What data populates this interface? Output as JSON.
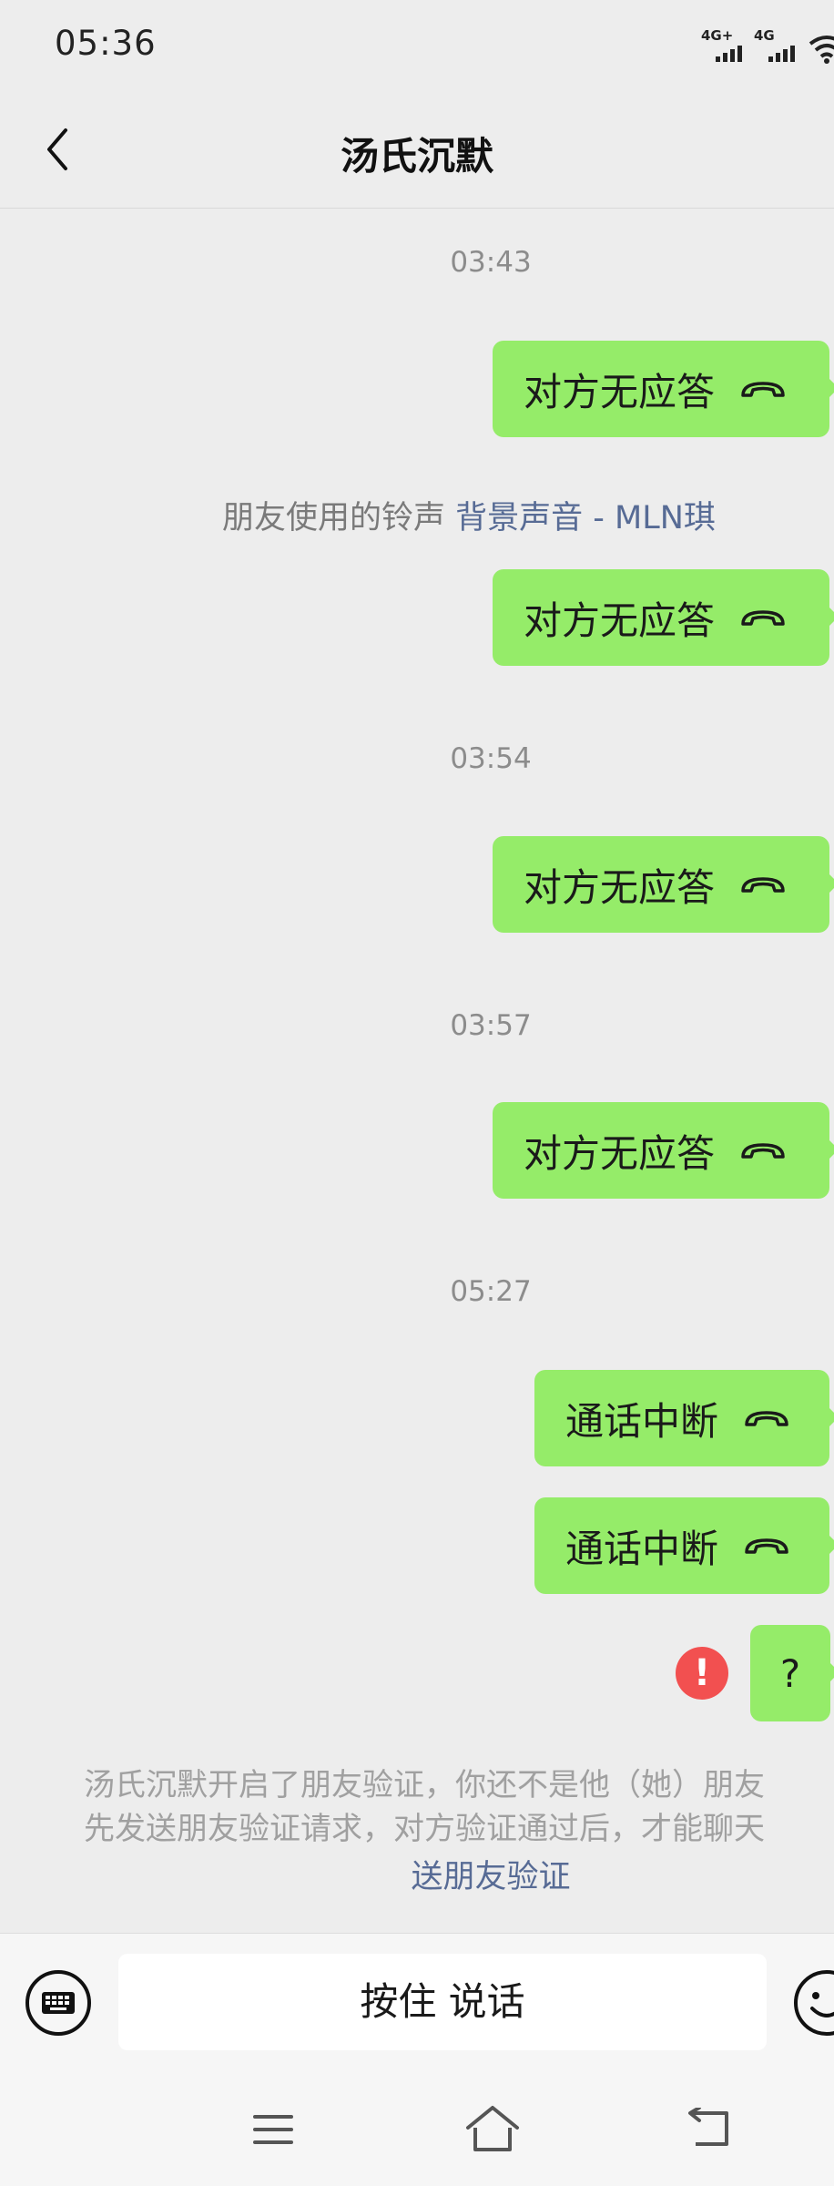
{
  "status_bar": {
    "time": "05:36",
    "network_1": "4G+",
    "network_2": "4G",
    "wifi_icon": "wifi-icon"
  },
  "header": {
    "title": "汤氏沉默",
    "back_icon": "back-arrow-icon"
  },
  "messages": [
    {
      "type": "timestamp",
      "text": "03:43"
    },
    {
      "type": "call",
      "text": "对方无应答",
      "icon": "hang-up-icon"
    },
    {
      "type": "system",
      "text": "朋友使用的铃声",
      "link": "背景声音 - MLN琪"
    },
    {
      "type": "call",
      "text": "对方无应答",
      "icon": "hang-up-icon"
    },
    {
      "type": "timestamp",
      "text": "03:54"
    },
    {
      "type": "call",
      "text": "对方无应答",
      "icon": "hang-up-icon"
    },
    {
      "type": "timestamp",
      "text": "03:57"
    },
    {
      "type": "call",
      "text": "对方无应答",
      "icon": "hang-up-icon"
    },
    {
      "type": "timestamp",
      "text": "05:27"
    },
    {
      "type": "call",
      "text": "通话中断",
      "icon": "hang-up-icon"
    },
    {
      "type": "call",
      "text": "通话中断",
      "icon": "hang-up-icon"
    },
    {
      "type": "text",
      "text": "?",
      "status": "send-failed",
      "status_mark": "!"
    }
  ],
  "notice": {
    "line1": "汤氏沉默开启了朋友验证，你还不是他（她）朋友",
    "line2": "先发送朋友验证请求，对方验证通过后，才能聊天",
    "link": "送朋友验证"
  },
  "input_bar": {
    "hold_to_talk": "按住 说话",
    "keyboard_icon": "keyboard-icon",
    "emoji_icon": "emoji-icon"
  },
  "nav_bar": {
    "menu_icon": "menu-icon",
    "home_icon": "home-icon",
    "back_icon": "return-icon"
  },
  "colors": {
    "bubble": "#95ec69",
    "background": "#ededed",
    "link": "#576b95",
    "error": "#f25050"
  }
}
